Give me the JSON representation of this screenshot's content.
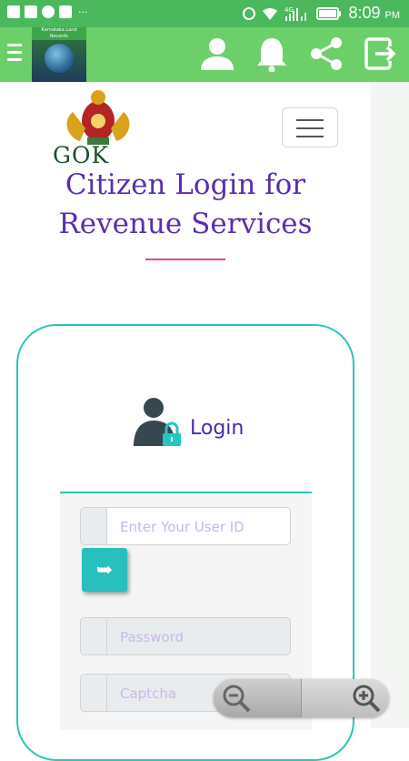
{
  "status_bar": {
    "time": "8:09",
    "ampm": "PM",
    "network": "4G",
    "sim": "2",
    "notif_icons": [
      "facebook-icon",
      "sim-icon",
      "whatsapp-icon",
      "gmail-icon"
    ],
    "overflow": "···"
  },
  "app_bar": {
    "logo_text": "Karnataka Land Records",
    "icons": [
      "profile-icon",
      "bell-icon",
      "share-icon",
      "logout-icon"
    ],
    "colors": {
      "bar": "#6ccf6a",
      "status": "#4bb85d"
    }
  },
  "header": {
    "emblem_label": "GOK",
    "title_line1": "Citizen Login for",
    "title_line2": "Revenue Services"
  },
  "login": {
    "heading": "Login",
    "user_id_placeholder": "Enter Your User ID",
    "password_placeholder": "Password",
    "captcha_placeholder": "Captcha",
    "go_button": "➥"
  },
  "colors": {
    "accent": "#2ec4b6",
    "title": "#5a2db0",
    "underline": "#e0488a"
  }
}
